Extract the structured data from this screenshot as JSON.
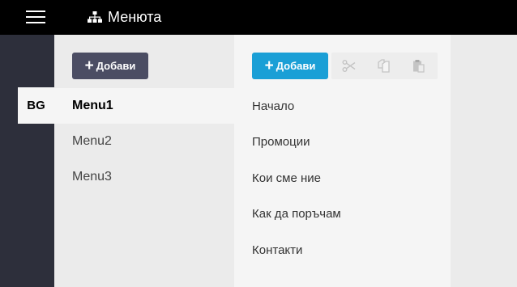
{
  "topbar": {
    "title": "Менюта",
    "menu_icon": "hamburger-icon",
    "title_icon": "sitemap-icon",
    "background": "#000000"
  },
  "languages": {
    "items": [
      {
        "label": "BG",
        "active": true
      }
    ],
    "background": "#2d2f3b"
  },
  "menus": {
    "add_label": "Добави",
    "add_button_color": "#4b4d63",
    "items": [
      {
        "label": "Menu1",
        "active": true
      },
      {
        "label": "Menu2",
        "active": false
      },
      {
        "label": "Menu3",
        "active": false
      }
    ]
  },
  "pages": {
    "add_label": "Добави",
    "add_button_color": "#1a9fd6",
    "tools": [
      "scissors-icon",
      "copy-icon",
      "paste-icon"
    ],
    "items": [
      {
        "label": "Начало"
      },
      {
        "label": "Промоции"
      },
      {
        "label": "Кои сме ние"
      },
      {
        "label": "Как да поръчам"
      },
      {
        "label": "Контакти"
      }
    ]
  }
}
